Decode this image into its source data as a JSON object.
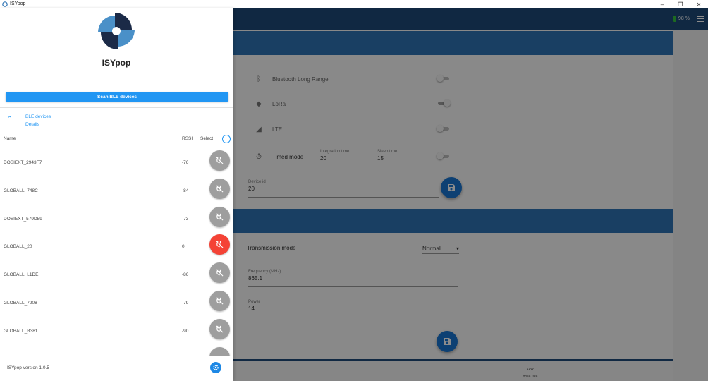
{
  "window": {
    "title": "ISYpop",
    "minimize": "–",
    "maximize": "❐",
    "close": "✕"
  },
  "header": {
    "battery": "98 %",
    "battery_color": "#36c23c",
    "menu_icon": "hamburger-icon"
  },
  "communication": {
    "ble": {
      "label": "Bluetooth Long Range",
      "icon": "bluetooth-icon",
      "enabled": false
    },
    "lora": {
      "label": "LoRa",
      "icon": "lora-icon",
      "enabled": true
    },
    "lte": {
      "label": "LTE",
      "icon": "signal-icon",
      "enabled": false
    },
    "timed": {
      "label": "Timed mode",
      "icon": "timer-icon",
      "integration_label": "Integration time",
      "integration_value": "20",
      "sleep_label": "Sleep time",
      "sleep_value": "15",
      "enabled": false
    },
    "device_id": {
      "label": "Device id",
      "value": "20"
    }
  },
  "lora_settings": {
    "transmission_label": "Transmission mode",
    "transmission_value": "Normal",
    "frequency": {
      "label": "Frequency (MHz)",
      "value": "865.1"
    },
    "power": {
      "label": "Power",
      "value": "14"
    }
  },
  "bottom_nav": {
    "dose_rate": {
      "label": "dose rate",
      "icon": "dose-rate-icon"
    }
  },
  "drawer": {
    "brand": "ISYpop",
    "scan_button": "Scan BLE devices",
    "section_title": "BLE devices",
    "section_subtitle": "Details",
    "columns": {
      "name": "Name",
      "rssi": "RSSI",
      "select": "Select"
    },
    "devices": [
      {
        "name": "DOSIEXT_2943F7",
        "rssi": "-76",
        "selected": false
      },
      {
        "name": "GLOBALL_748C",
        "rssi": "-84",
        "selected": false
      },
      {
        "name": "DOSIEXT_579D59",
        "rssi": "-73",
        "selected": false
      },
      {
        "name": "GLOBALL_20",
        "rssi": "0",
        "selected": true
      },
      {
        "name": "GLOBALL_L1DE",
        "rssi": "-86",
        "selected": false
      },
      {
        "name": "GLOBALL_7908",
        "rssi": "-79",
        "selected": false
      },
      {
        "name": "GLOBALL_B381",
        "rssi": "-90",
        "selected": false
      }
    ],
    "version": "ISYpop version 1.0.5"
  },
  "colors": {
    "primary": "#1976d2",
    "app_bar": "#1e4a78",
    "section": "#2f74b5",
    "selected": "#f44336",
    "unselected": "#9e9e9e"
  }
}
